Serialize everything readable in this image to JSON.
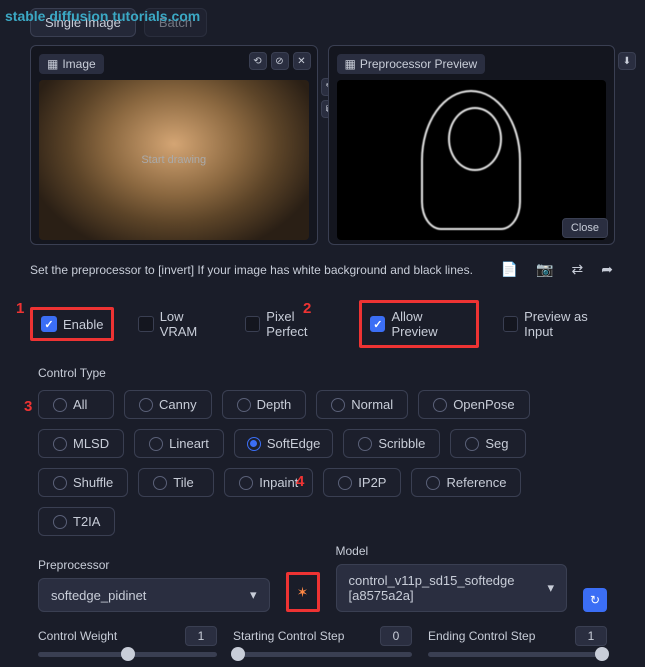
{
  "watermark": "stable diffusion tutorials.com",
  "tabs": {
    "single": "Single Image",
    "batch": "Batch"
  },
  "panel1": {
    "label": "Image",
    "startDraw": "Start drawing"
  },
  "panel2": {
    "label": "Preprocessor Preview",
    "close": "Close"
  },
  "hint": "Set the preprocessor to [invert] If your image has white background and black lines.",
  "checks": {
    "enable": "Enable",
    "lowvram": "Low VRAM",
    "pixelperfect": "Pixel Perfect",
    "allowpreview": "Allow Preview",
    "previewinput": "Preview as Input"
  },
  "controlTypeLabel": "Control Type",
  "controlTypes": [
    "All",
    "Canny",
    "Depth",
    "Normal",
    "OpenPose",
    "MLSD",
    "Lineart",
    "SoftEdge",
    "Scribble",
    "Seg",
    "Shuffle",
    "Tile",
    "Inpaint",
    "IP2P",
    "Reference",
    "T2IA"
  ],
  "controlTypeSelected": "SoftEdge",
  "preprocessor": {
    "label": "Preprocessor",
    "value": "softedge_pidinet"
  },
  "model": {
    "label": "Model",
    "value": "control_v11p_sd15_softedge [a8575a2a]"
  },
  "sliders": {
    "weight": {
      "label": "Control Weight",
      "value": "1",
      "pct": 50
    },
    "start": {
      "label": "Starting Control Step",
      "value": "0",
      "pct": 3
    },
    "end": {
      "label": "Ending Control Step",
      "value": "1",
      "pct": 97
    }
  },
  "annotations": {
    "a1": "1",
    "a2": "2",
    "a3": "3",
    "a4": "4"
  }
}
